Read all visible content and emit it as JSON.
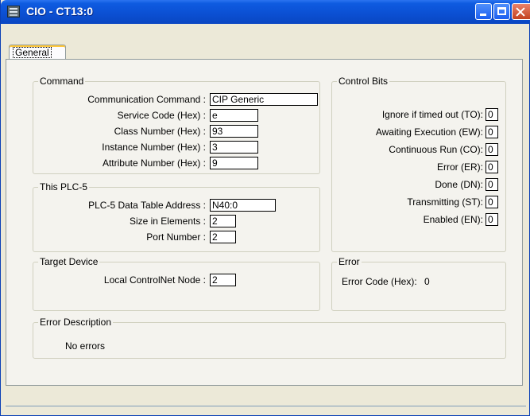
{
  "window": {
    "title": "CIO - CT13:0"
  },
  "tabs": [
    {
      "label": "General"
    }
  ],
  "command": {
    "legend": "Command",
    "fields": [
      {
        "label": "Communication Command :",
        "value": "CIP Generic"
      },
      {
        "label": "Service Code (Hex) :",
        "value": "e"
      },
      {
        "label": "Class Number (Hex) :",
        "value": "93"
      },
      {
        "label": "Instance Number (Hex) :",
        "value": "3"
      },
      {
        "label": "Attribute Number (Hex) :",
        "value": "9"
      }
    ]
  },
  "plc5": {
    "legend": "This PLC-5",
    "fields": [
      {
        "label": "PLC-5 Data Table Address :",
        "value": "N40:0"
      },
      {
        "label": "Size in Elements :",
        "value": "2"
      },
      {
        "label": "Port Number :",
        "value": "2"
      }
    ]
  },
  "target": {
    "legend": "Target Device",
    "fields": [
      {
        "label": "Local ControlNet Node :",
        "value": "2"
      }
    ]
  },
  "control_bits": {
    "legend": "Control Bits",
    "items": [
      {
        "label": "Ignore if timed out (TO):",
        "value": "0"
      },
      {
        "label": "Awaiting Execution (EW):",
        "value": "0"
      },
      {
        "label": "Continuous Run (CO):",
        "value": "0"
      },
      {
        "label": "Error (ER):",
        "value": "0"
      },
      {
        "label": "Done (DN):",
        "value": "0"
      },
      {
        "label": "Transmitting (ST):",
        "value": "0"
      },
      {
        "label": "Enabled (EN):",
        "value": "0"
      }
    ]
  },
  "error": {
    "legend": "Error",
    "label": "Error Code (Hex):",
    "value": "0"
  },
  "error_description": {
    "legend": "Error Description",
    "text": "No errors"
  }
}
